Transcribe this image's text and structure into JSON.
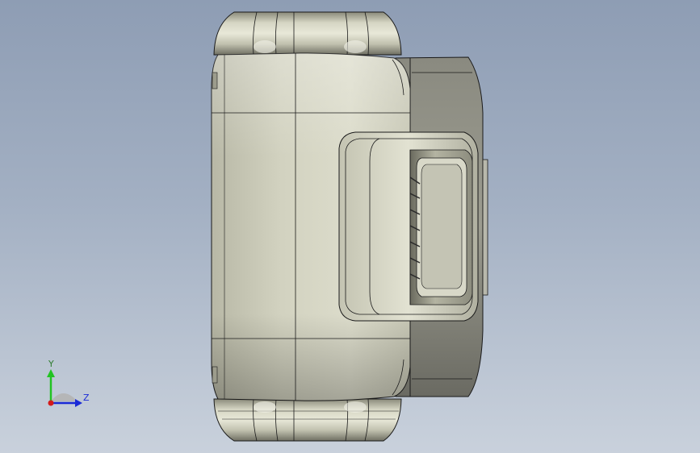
{
  "viewport": {
    "background_top": "#8e9db4",
    "background_bottom": "#c9d1dc",
    "model_color": "#c8c8b4",
    "edge_color": "#1a1a1a"
  },
  "triad": {
    "y_label": "Y",
    "z_label": "Z",
    "y_color": "#22c322",
    "z_color": "#1a2ad6",
    "x_color": "#d41a1a",
    "plane_color": "#b4b4b4"
  }
}
